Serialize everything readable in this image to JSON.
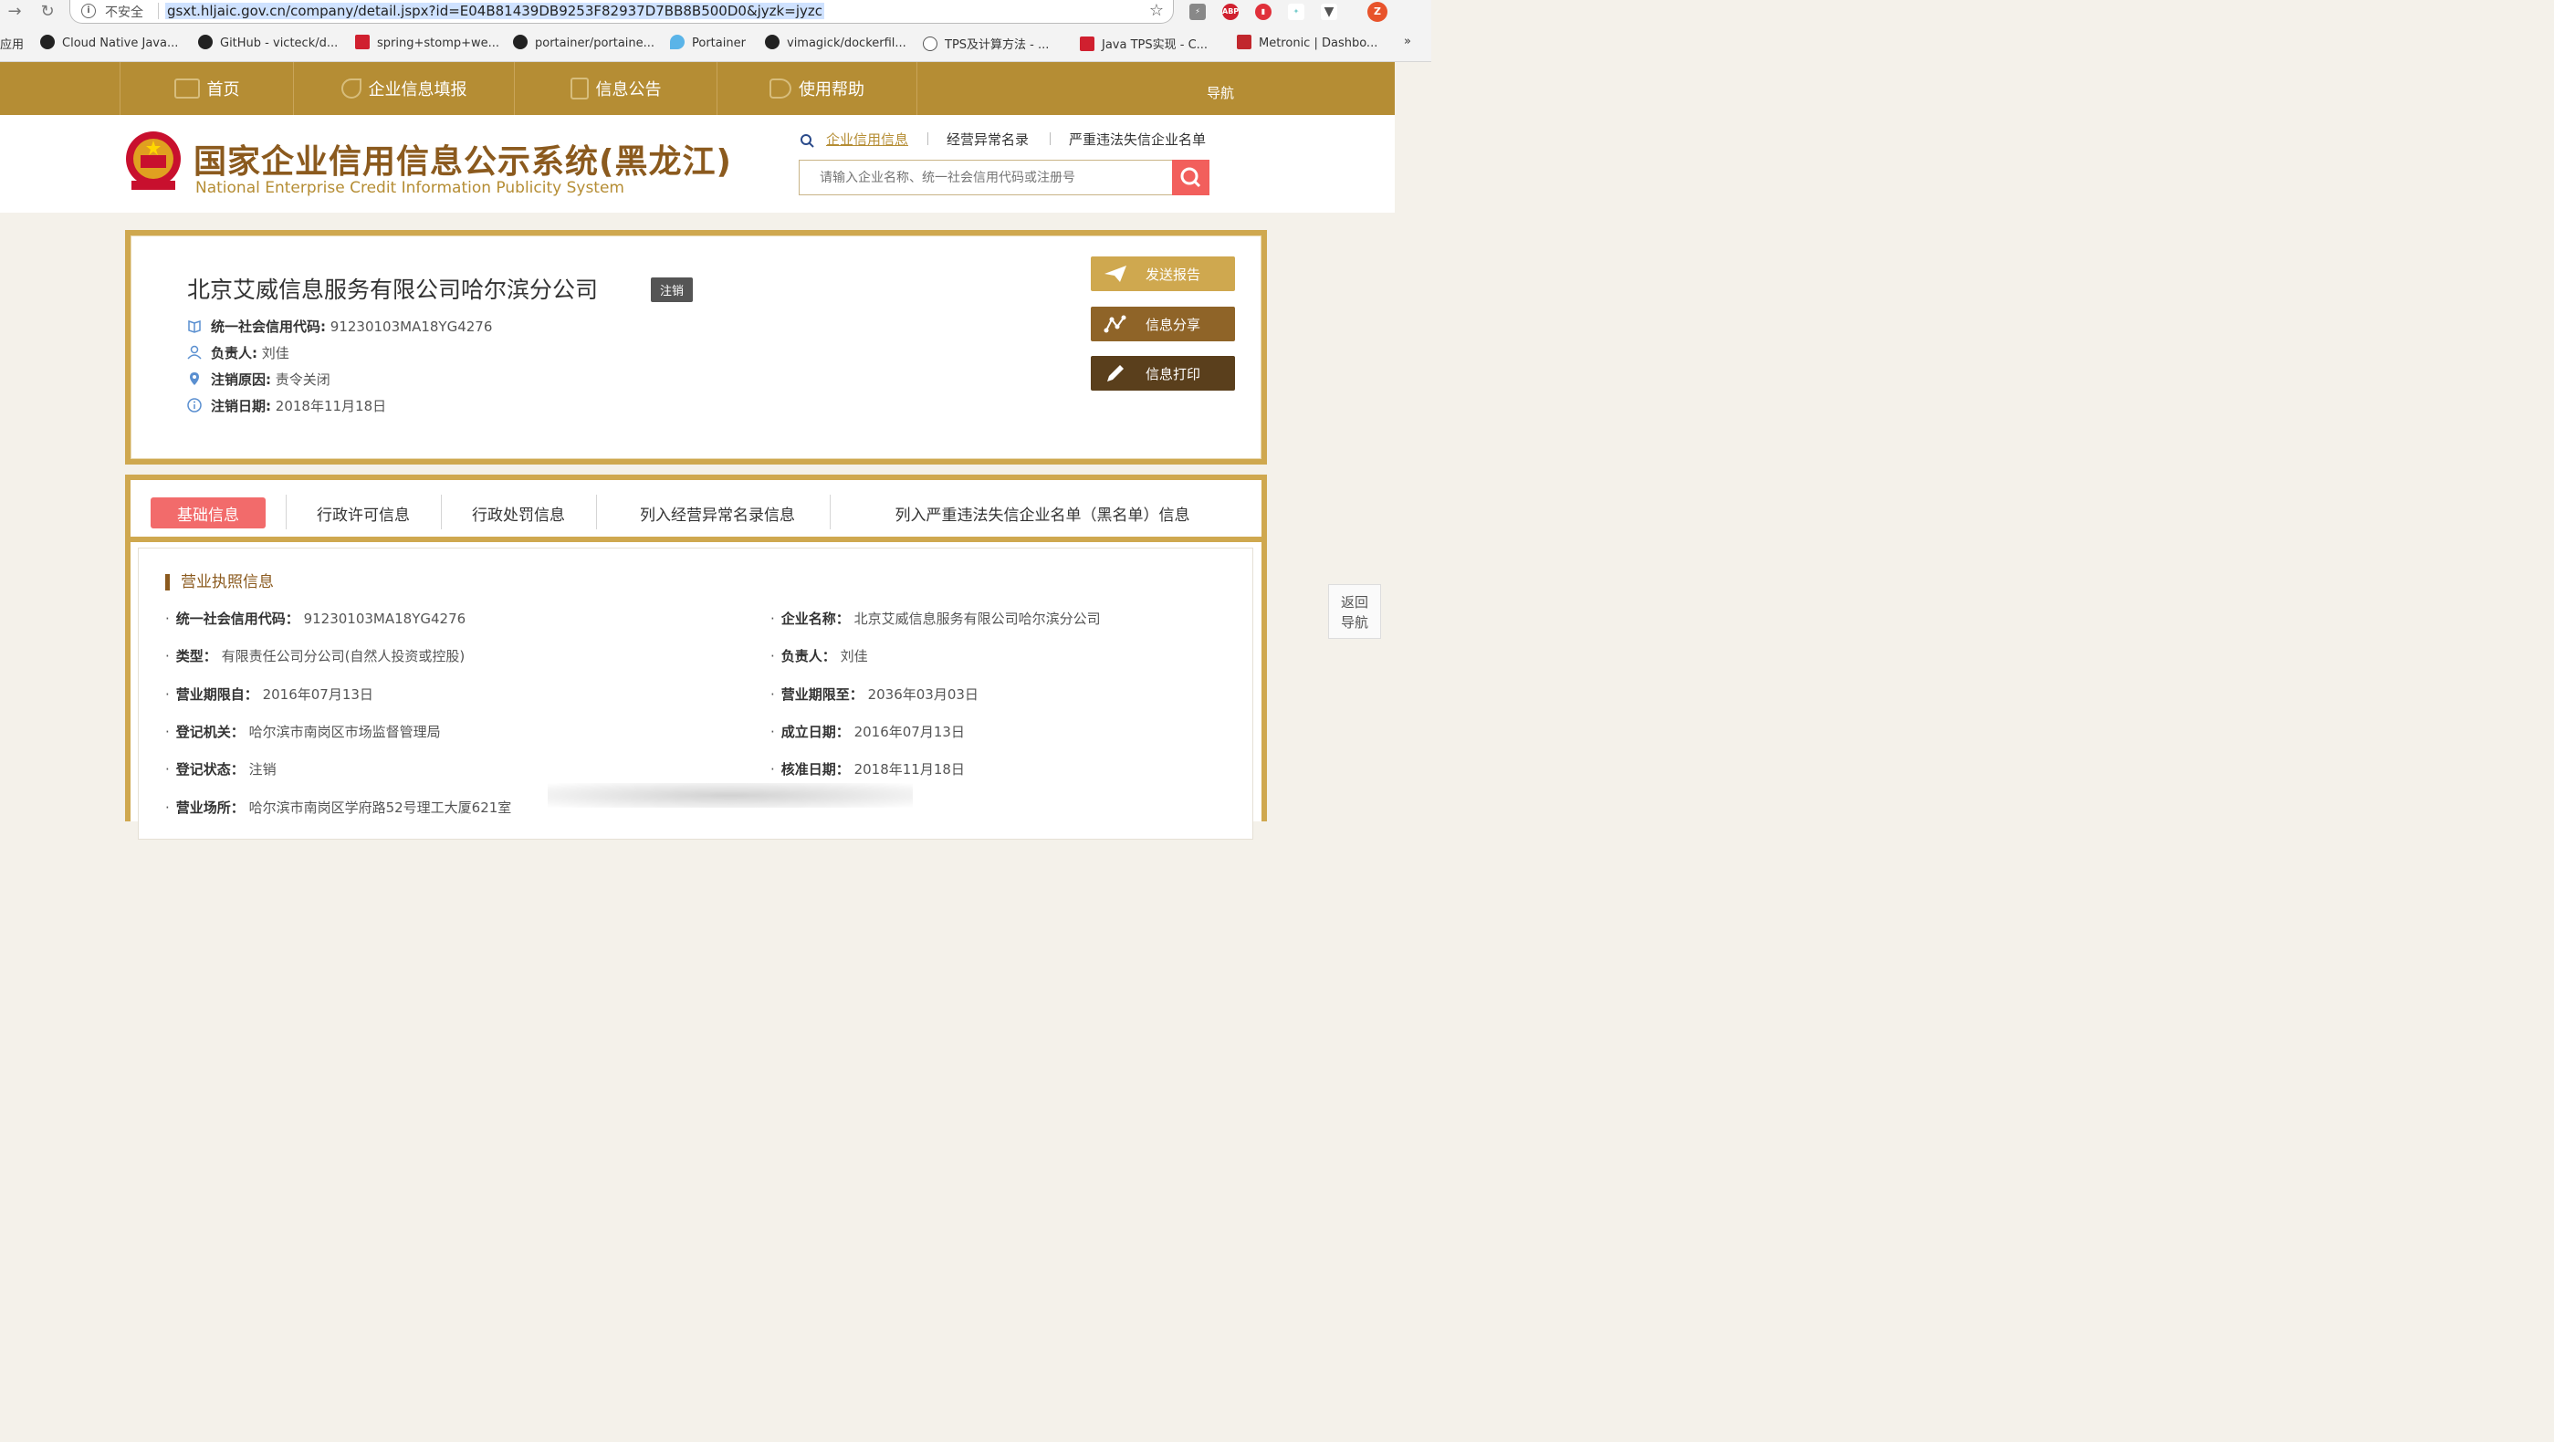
{
  "browser": {
    "insecure_label": "不安全",
    "url": "gsxt.hljaic.gov.cn/company/detail.jspx?id=E04B81439DB9253F82937D7BB8B500D0&jyzk=jyzc",
    "bookmarks": [
      {
        "label": "应用",
        "icon": "apps-icon"
      },
      {
        "label": "Cloud Native Java...",
        "icon": "github-icon"
      },
      {
        "label": "GitHub - victeck/d...",
        "icon": "github-icon"
      },
      {
        "label": "spring+stomp+we...",
        "icon": "csdn-icon"
      },
      {
        "label": "portainer/portaine...",
        "icon": "github-icon"
      },
      {
        "label": "Portainer",
        "icon": "portainer-icon"
      },
      {
        "label": "vimagick/dockerfil...",
        "icon": "github-icon"
      },
      {
        "label": "TPS及计算方法 - ...",
        "icon": "link-icon"
      },
      {
        "label": "Java TPS实现 - C...",
        "icon": "csdn-icon"
      },
      {
        "label": "Metronic | Dashbo...",
        "icon": "metronic-icon"
      }
    ],
    "more": "»",
    "ext_abp": "ABP",
    "profile": "Z"
  },
  "topnav": {
    "items": [
      "首页",
      "企业信息填报",
      "信息公告",
      "使用帮助"
    ],
    "nav_label": "导航"
  },
  "header": {
    "title": "国家企业信用信息公示系统(黑龙江)",
    "subtitle": "National Enterprise Credit Information Publicity System",
    "search_links": [
      "企业信用信息",
      "经营异常名录",
      "严重违法失信企业名单"
    ],
    "search_placeholder": "请输入企业名称、统一社会信用代码或注册号"
  },
  "company": {
    "name": "北京艾威信息服务有限公司哈尔滨分公司",
    "status_badge": "注销",
    "credit_code_label": "统一社会信用代码:",
    "credit_code": "91230103MA18YG4276",
    "person_label": "负责人:",
    "person": "刘佳",
    "cancel_reason_label": "注销原因:",
    "cancel_reason": "责令关闭",
    "cancel_date_label": "注销日期:",
    "cancel_date": "2018年11月18日",
    "actions": [
      "发送报告",
      "信息分享",
      "信息打印"
    ],
    "colors": {
      "send": "#cfa84f",
      "share": "#8f6428",
      "print": "#5a3f1c"
    }
  },
  "tabs": [
    "基础信息",
    "行政许可信息",
    "行政处罚信息",
    "列入经营异常名录信息",
    "列入严重违法失信企业名单（黑名单）信息"
  ],
  "license": {
    "section_title": "营业执照信息",
    "left": [
      {
        "label": "统一社会信用代码：",
        "value": "91230103MA18YG4276"
      },
      {
        "label": "类型：",
        "value": "有限责任公司分公司(自然人投资或控股)"
      },
      {
        "label": "营业期限自：",
        "value": "2016年07月13日"
      },
      {
        "label": "登记机关：",
        "value": "哈尔滨市南岗区市场监督管理局"
      },
      {
        "label": "登记状态：",
        "value": "注销"
      },
      {
        "label": "营业场所：",
        "value": "哈尔滨市南岗区学府路52号理工大厦621室"
      }
    ],
    "right": [
      {
        "label": "企业名称：",
        "value": "北京艾威信息服务有限公司哈尔滨分公司"
      },
      {
        "label": "负责人：",
        "value": "刘佳"
      },
      {
        "label": "营业期限至：",
        "value": "2036年03月03日"
      },
      {
        "label": "成立日期：",
        "value": "2016年07月13日"
      },
      {
        "label": "核准日期：",
        "value": "2018年11月18日"
      }
    ]
  },
  "back_nav": {
    "line1": "返回",
    "line2": "导航"
  }
}
